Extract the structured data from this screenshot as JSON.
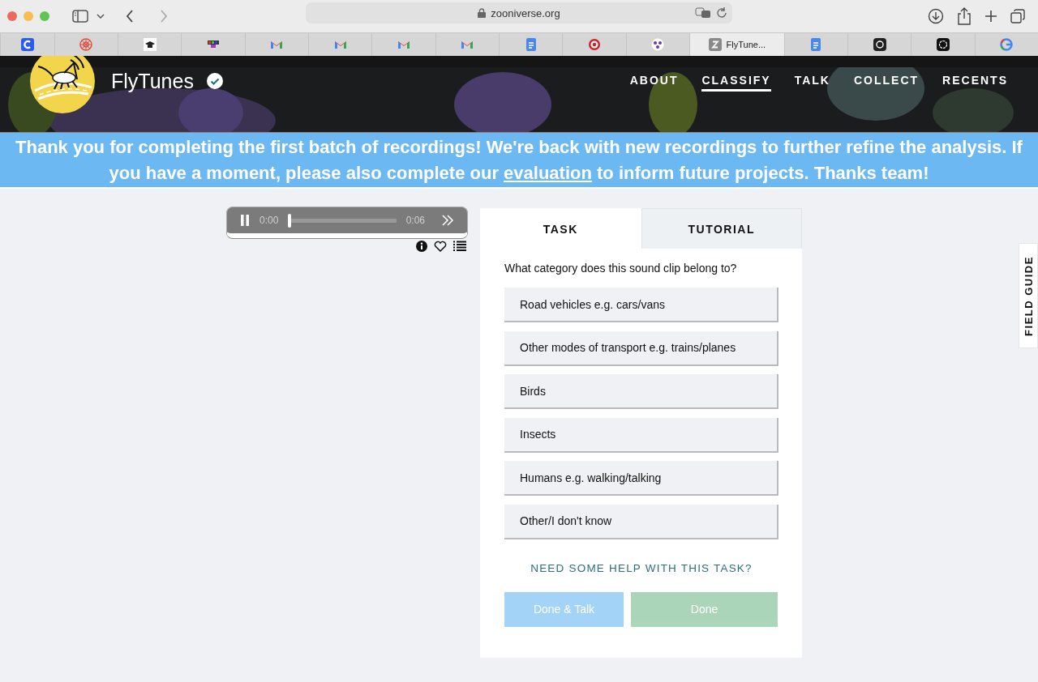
{
  "browser": {
    "address": "zooniverse.org",
    "tabs": [
      {
        "selected": false
      },
      {
        "selected": false
      },
      {
        "selected": false
      },
      {
        "selected": false
      },
      {
        "selected": false
      },
      {
        "selected": false
      },
      {
        "selected": false
      },
      {
        "selected": false
      },
      {
        "selected": false
      },
      {
        "selected": false
      },
      {
        "selected": false
      },
      {
        "selected": true,
        "label": "FlyTune..."
      },
      {
        "selected": false
      },
      {
        "selected": false
      },
      {
        "selected": false
      },
      {
        "selected": false
      }
    ]
  },
  "header": {
    "project_name": "FlyTunes",
    "verified": true,
    "nav": [
      {
        "label": "ABOUT",
        "selected": false
      },
      {
        "label": "CLASSIFY",
        "selected": true
      },
      {
        "label": "TALK",
        "selected": false
      },
      {
        "label": "COLLECT",
        "selected": false
      },
      {
        "label": "RECENTS",
        "selected": false
      }
    ]
  },
  "banner": {
    "text_before": "Thank you for completing the first batch of recordings! We're back with new recordings to further refine the analysis. If you have a moment, please also complete our",
    "link": "evaluation",
    "text_after": "to inform future projects. Thanks team!"
  },
  "player": {
    "playing": true,
    "elapsed": "0:00",
    "duration": "0:06",
    "level": 0.0
  },
  "task_panel": {
    "tabs": [
      {
        "label": "TASK",
        "selected": true
      },
      {
        "label": "TUTORIAL",
        "selected": false
      }
    ],
    "question": "What category does this sound clip belong to?",
    "answers": [
      {
        "label": "Road vehicles e.g. cars/vans",
        "selected": false
      },
      {
        "label": "Other modes of transport e.g. trains/planes",
        "selected": false
      },
      {
        "label": "Birds",
        "selected": false
      },
      {
        "label": "Insects",
        "selected": false
      },
      {
        "label": "Humans e.g. walking/talking",
        "selected": false
      },
      {
        "label": "Other/I don't know",
        "selected": false
      }
    ],
    "help_link": "NEED SOME HELP WITH THIS TASK?",
    "buttons": [
      {
        "label": "Done & Talk",
        "kind": "talk",
        "disabled": true
      },
      {
        "label": "Done",
        "kind": "done",
        "disabled": true
      }
    ]
  },
  "field_guide": {
    "label": "FIELD GUIDE"
  }
}
